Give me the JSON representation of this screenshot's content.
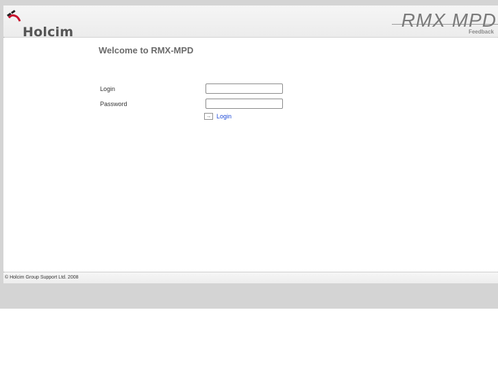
{
  "header": {
    "logo_text": "Holcim",
    "brand_title": "RMX MPD",
    "brand_subtitle": "Feedback"
  },
  "main": {
    "welcome": "Welcome to RMX-MPD",
    "login_label": "Login",
    "password_label": "Password",
    "login_value": "",
    "password_value": "",
    "login_button": "Login"
  },
  "footer": {
    "copyright": "© Holcim Group Support Ltd. 2008"
  },
  "icons": {
    "logo": "holcim-logo-icon",
    "login_button": "arrow-right-icon"
  }
}
